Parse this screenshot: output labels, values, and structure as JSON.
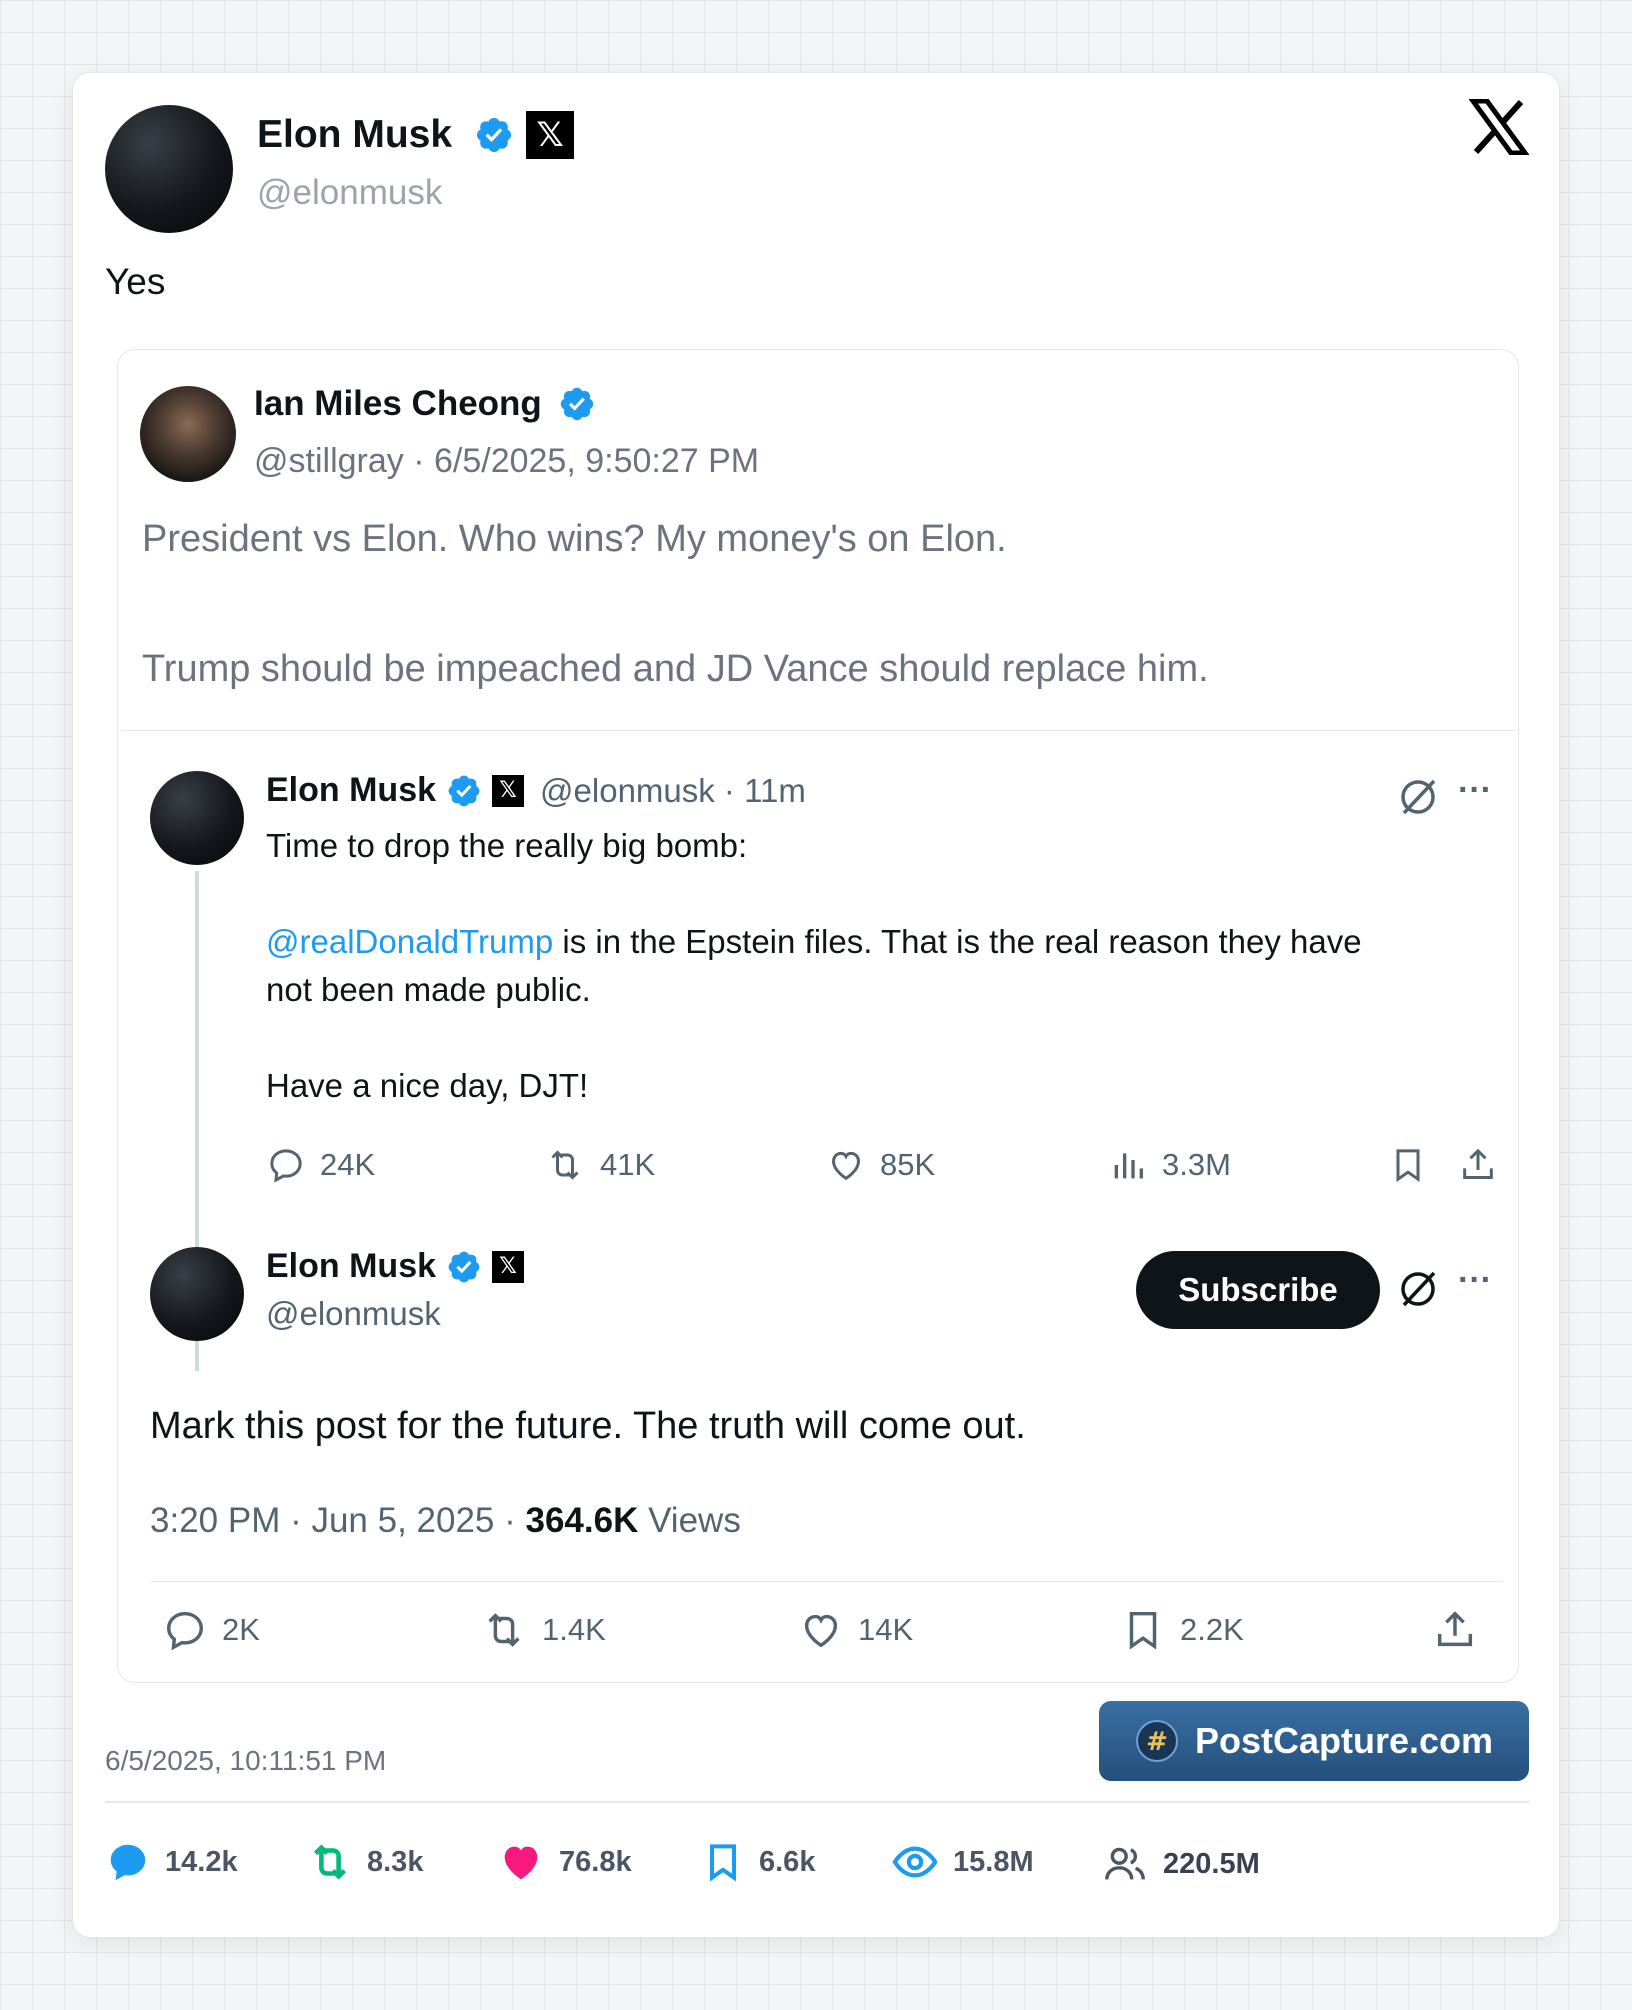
{
  "main_post": {
    "author_name": "Elon Musk",
    "author_handle": "@elonmusk",
    "text": "Yes",
    "timestamp": "6/5/2025, 10:11:51 PM",
    "brand_button": "PostCapture.com"
  },
  "quoted_post": {
    "author_name": "Ian Miles Cheong",
    "author_handle": "@stillgray",
    "meta": "· 6/5/2025, 9:50:27 PM",
    "line1": "President vs Elon. Who wins? My money's on Elon.",
    "line2": "Trump should be impeached and JD Vance should replace him."
  },
  "screenshot": {
    "post1": {
      "name": "Elon Musk",
      "handle_time": "@elonmusk · 11m",
      "line1": "Time to drop the really big bomb:",
      "mention": "@realDonaldTrump",
      "line2_rest": " is in the Epstein files. That is the real reason they have",
      "line3": "not been made public.",
      "line4": "Have a nice day, DJT!",
      "replies": "24K",
      "reposts": "41K",
      "likes": "85K",
      "views": "3.3M"
    },
    "post2": {
      "name": "Elon Musk",
      "handle": "@elonmusk",
      "subscribe": "Subscribe",
      "text": "Mark this post for the future. The truth will come out.",
      "time_date": "3:20 PM · Jun 5, 2025 · ",
      "views_count": "364.6K",
      "views_label": " Views",
      "replies": "2K",
      "reposts": "1.4K",
      "likes": "14K",
      "bookmarks": "2.2K"
    }
  },
  "footer_stats": {
    "replies": "14.2k",
    "reposts": "8.3k",
    "likes": "76.8k",
    "bookmarks": "6.6k",
    "views": "15.8M",
    "followers": "220.5M"
  },
  "colors": {
    "verified": "#1d9bf0",
    "repost": "#00ba7c",
    "like": "#f91880",
    "brand_button": "#2d5d8a"
  }
}
